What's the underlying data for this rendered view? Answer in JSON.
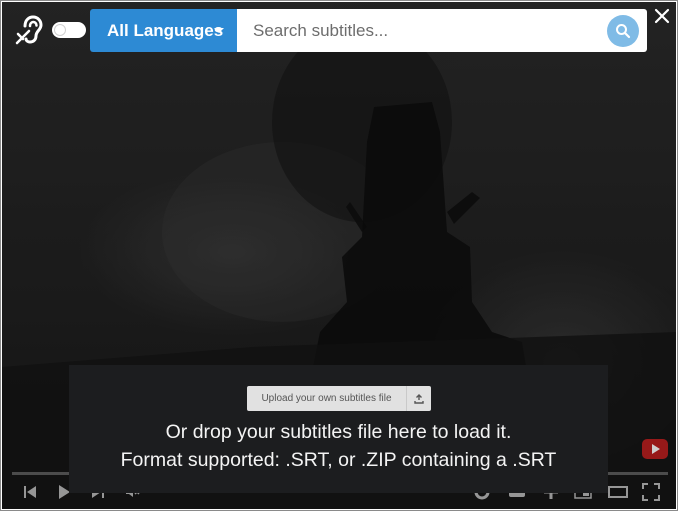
{
  "toolbar": {
    "accessibility_icon": "hearing-assist-icon",
    "language_button_label": "All Languages",
    "search_placeholder": "Search subtitles...",
    "search_icon": "search-icon",
    "close_icon": "close-icon"
  },
  "upload": {
    "button_label": "Upload your own subtitles file",
    "button_icon": "upload-icon",
    "drop_line1": "Or drop your subtitles file here to load it.",
    "drop_line2": "Format supported: .SRT, or .ZIP containing a .SRT"
  },
  "player": {
    "controls": [
      "previous-icon",
      "play-icon",
      "next-icon",
      "volume-icon",
      "settings-icon",
      "subtitles-icon",
      "cast-icon",
      "miniplayer-icon",
      "theater-icon",
      "fullscreen-icon"
    ],
    "brand_icon": "youtube-icon"
  },
  "colors": {
    "accent": "#2d8ad4",
    "search_button": "#7fbbe6",
    "panel_bg": "#1c1d1f"
  }
}
